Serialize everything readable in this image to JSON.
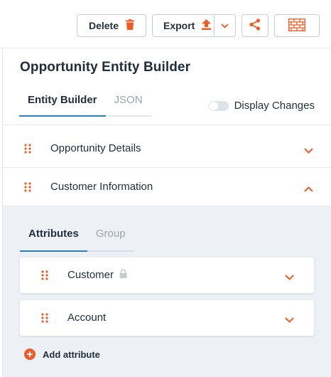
{
  "toolbar": {
    "delete_label": "Delete",
    "export_label": "Export"
  },
  "panel": {
    "title": "Opportunity Entity Builder",
    "tabs": [
      {
        "label": "Entity Builder",
        "active": true
      },
      {
        "label": "JSON",
        "active": false
      }
    ],
    "display_changes_label": "Display Changes",
    "display_changes_on": false
  },
  "sections": [
    {
      "label": "Opportunity Details",
      "expanded": false
    },
    {
      "label": "Customer Information",
      "expanded": true
    }
  ],
  "sub_tabs": [
    {
      "label": "Attributes",
      "active": true
    },
    {
      "label": "Group",
      "active": false
    }
  ],
  "attributes": [
    {
      "label": "Customer",
      "locked": true
    },
    {
      "label": "Account",
      "locked": false
    }
  ],
  "add_attribute_label": "Add attribute",
  "colors": {
    "accent": "#f15a24",
    "tab_active": "#2d7fc1",
    "text": "#1f2d3d",
    "muted": "#9aa4ae"
  },
  "icons": {
    "delete": "trash-icon",
    "export": "upload-icon",
    "export_menu": "chevron-down-icon",
    "share": "share-icon",
    "layout": "brick-wall-icon",
    "drag": "drag-handle-icon",
    "lock": "lock-icon",
    "add": "plus-circle-icon"
  }
}
